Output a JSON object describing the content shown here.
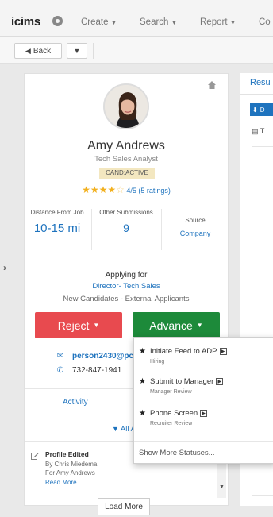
{
  "app": {
    "logo_text": "icims"
  },
  "nav": {
    "items": [
      {
        "label": "Create"
      },
      {
        "label": "Search"
      },
      {
        "label": "Report"
      },
      {
        "label": "Co"
      }
    ]
  },
  "toolbar": {
    "back_label": "Back"
  },
  "candidate": {
    "name": "Amy Andrews",
    "title": "Tech Sales Analyst",
    "status": "CAND:ACTIVE",
    "rating_text": "4/5 (5 ratings)",
    "rating_value": 4,
    "rating_max": 5,
    "stats": [
      {
        "label": "Distance From Job",
        "value": "10-15 mi"
      },
      {
        "label": "Other Submissions",
        "value": "9"
      },
      {
        "label": "Source",
        "value": "Company"
      }
    ],
    "applying_label": "Applying for",
    "job": "Director- Tech Sales",
    "workflow": "New Candidates - External Applicants",
    "email": "person2430@pc",
    "phone": "732-847-1941"
  },
  "actions": {
    "reject_label": "Reject",
    "advance_label": "Advance"
  },
  "activity": {
    "tab_label": "Activity",
    "filter_label": "All Activ",
    "items": [
      {
        "title": "Profile Edited",
        "by": "By Chris Miedema",
        "for": "For Amy Andrews",
        "read_more": "Read More"
      }
    ],
    "load_more": "Load More"
  },
  "right_panel": {
    "tab_label": "Resu",
    "download_label": "D",
    "doc_label": "T"
  },
  "advance_menu": {
    "items": [
      {
        "label": "Initiate Feed to ADP",
        "sub": "Hiring"
      },
      {
        "label": "Submit to Manager",
        "sub": "Manager Review"
      },
      {
        "label": "Phone Screen",
        "sub": "Recruiter Review"
      }
    ],
    "more_label": "Show More Statuses..."
  },
  "colors": {
    "reject": "#e84a4f",
    "advance": "#1d8a3a",
    "link": "#1e73be",
    "star": "#f2b01e"
  }
}
